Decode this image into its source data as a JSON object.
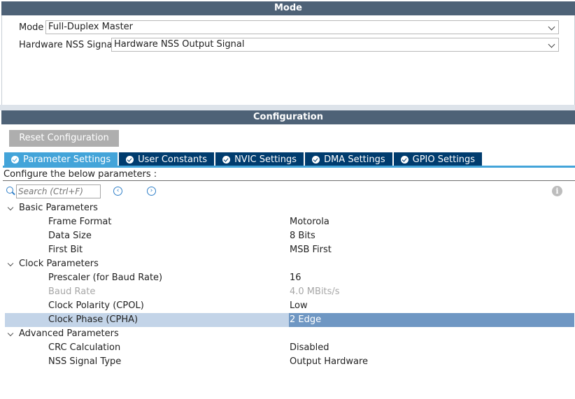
{
  "mode_panel": {
    "title": "Mode",
    "mode": {
      "label": "Mode",
      "value": "Full-Duplex Master"
    },
    "nss": {
      "label": "Hardware NSS Signal",
      "value": "Hardware NSS Output Signal"
    }
  },
  "config_panel": {
    "title": "Configuration",
    "reset_label": "Reset Configuration",
    "tabs": [
      {
        "label": "Parameter Settings",
        "active": true
      },
      {
        "label": "User Constants",
        "active": false
      },
      {
        "label": "NVIC Settings",
        "active": false
      },
      {
        "label": "DMA Settings",
        "active": false
      },
      {
        "label": "GPIO Settings",
        "active": false
      }
    ],
    "hint": "Configure the below parameters :",
    "search": {
      "placeholder": "Search (Ctrl+F)"
    },
    "nav": {
      "prev_glyph": "‹",
      "next_glyph": "›"
    },
    "info_glyph": "i"
  },
  "parameters": {
    "basic": {
      "label": "Basic Parameters",
      "items": [
        {
          "name": "Frame Format",
          "value": "Motorola"
        },
        {
          "name": "Data Size",
          "value": "8 Bits"
        },
        {
          "name": "First Bit",
          "value": "MSB First"
        }
      ]
    },
    "clock": {
      "label": "Clock Parameters",
      "items": [
        {
          "name": "Prescaler (for Baud Rate)",
          "value": "16"
        },
        {
          "name": "Baud Rate",
          "value": "4.0 MBits/s",
          "disabled": true
        },
        {
          "name": "Clock Polarity (CPOL)",
          "value": "Low"
        },
        {
          "name": "Clock Phase (CPHA)",
          "value": "2 Edge",
          "selected": true
        }
      ]
    },
    "advanced": {
      "label": "Advanced Parameters",
      "items": [
        {
          "name": "CRC Calculation",
          "value": "Disabled"
        },
        {
          "name": "NSS Signal Type",
          "value": "Output Hardware"
        }
      ]
    }
  },
  "colors": {
    "header_bg": "#4e6277",
    "tab_bg": "#003c6e",
    "tab_active_bg": "#43a4d9",
    "selection_bg": "#c3d4e8",
    "selection_value_bg": "#6f97c3"
  }
}
